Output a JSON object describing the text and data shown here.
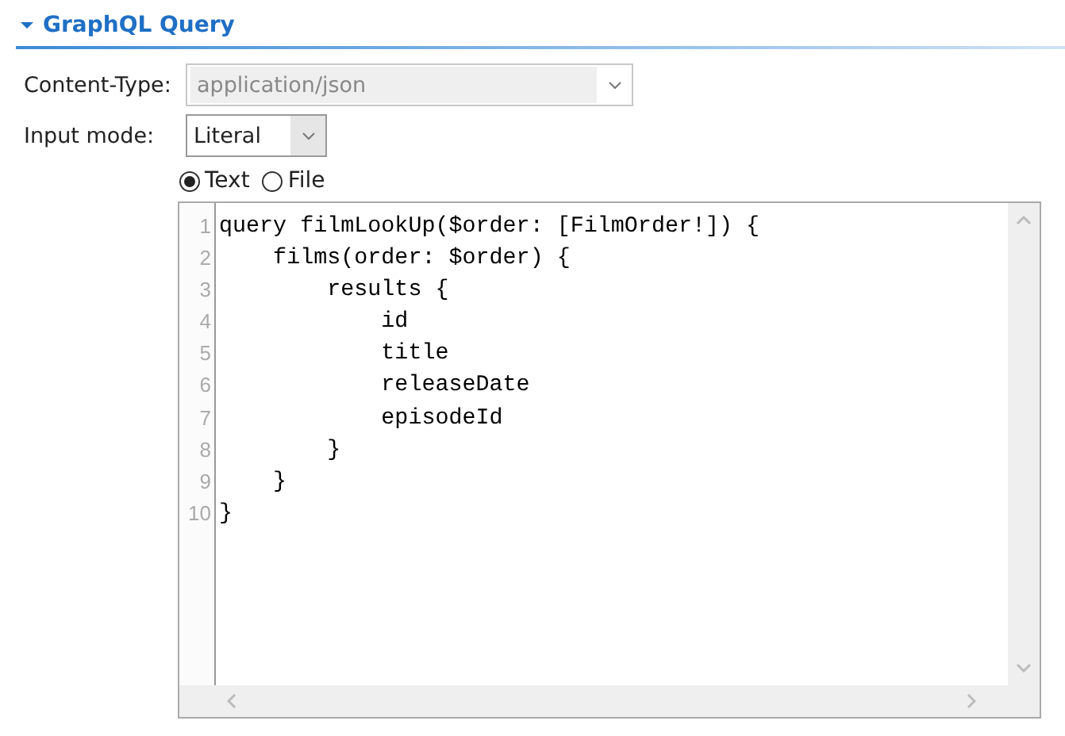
{
  "section": {
    "title": "GraphQL Query",
    "expanded": true
  },
  "content_type": {
    "label": "Content-Type:",
    "value": "application/json",
    "disabled": true
  },
  "input_mode": {
    "label": "Input mode:",
    "value": "Literal"
  },
  "source_options": [
    {
      "label": "Text",
      "selected": true
    },
    {
      "label": "File",
      "selected": false
    }
  ],
  "editor": {
    "lines": [
      {
        "number": "1",
        "text": "query filmLookUp($order: [FilmOrder!]) {"
      },
      {
        "number": "2",
        "text": "    films(order: $order) {"
      },
      {
        "number": "3",
        "text": "        results {"
      },
      {
        "number": "4",
        "text": "            id"
      },
      {
        "number": "5",
        "text": "            title"
      },
      {
        "number": "6",
        "text": "            releaseDate"
      },
      {
        "number": "7",
        "text": "            episodeId"
      },
      {
        "number": "8",
        "text": "        }"
      },
      {
        "number": "9",
        "text": "    }"
      },
      {
        "number": "10",
        "text": "}"
      }
    ]
  }
}
